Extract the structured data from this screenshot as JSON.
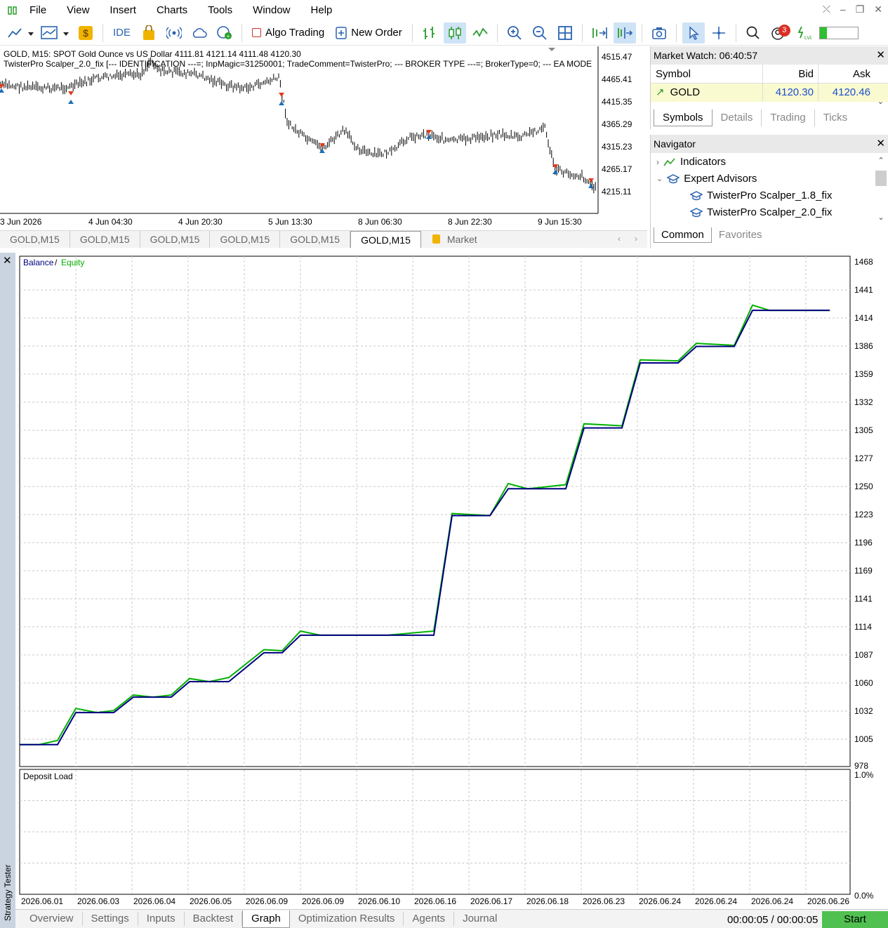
{
  "menu": [
    "File",
    "View",
    "Insert",
    "Charts",
    "Tools",
    "Window",
    "Help"
  ],
  "toolbar": {
    "ide_label": "IDE",
    "algo_trading_label": "Algo Trading",
    "new_order_label": "New Order",
    "notification_count": "3"
  },
  "price_chart": {
    "info_line1": "GOLD, M15:  SPOT Gold Ounce vs US Dollar  4111.81 4121.14 4111.48 4120.30",
    "info_line2": "TwisterPro Scalper_2.0_fix [--- IDENTIFICATION ---=; InpMagic=31250001; TradeComment=TwisterPro; --- BROKER TYPE ---=; BrokerType=0; --- EA MODE",
    "price_ticks": [
      "4515.47",
      "4465.41",
      "4415.35",
      "4365.29",
      "4315.23",
      "4265.17",
      "4215.11"
    ],
    "time_ticks": [
      "3 Jun 2026",
      "4 Jun 04:30",
      "4 Jun 20:30",
      "5 Jun 13:30",
      "8 Jun 06:30",
      "8 Jun 22:30",
      "9 Jun 15:30"
    ]
  },
  "chart_tabs": [
    "GOLD,M15",
    "GOLD,M15",
    "GOLD,M15",
    "GOLD,M15",
    "GOLD,M15",
    "GOLD,M15",
    "Market"
  ],
  "market_watch": {
    "title": "Market Watch: 06:40:57",
    "col_symbol": "Symbol",
    "col_bid": "Bid",
    "col_ask": "Ask",
    "symbol": "GOLD",
    "bid": "4120.30",
    "ask": "4120.46",
    "tabs": [
      "Symbols",
      "Details",
      "Trading",
      "Ticks"
    ]
  },
  "navigator": {
    "title": "Navigator",
    "indicators": "Indicators",
    "expert_advisors": "Expert Advisors",
    "ea1": "TwisterPro Scalper_1.8_fix",
    "ea2": "TwisterPro Scalper_2.0_fix",
    "tabs": [
      "Common",
      "Favorites"
    ]
  },
  "tester": {
    "side_label": "Strategy Tester",
    "tabs": [
      "Overview",
      "Settings",
      "Inputs",
      "Backtest",
      "Graph",
      "Optimization Results",
      "Agents",
      "Journal"
    ],
    "time": "00:00:05 / 00:00:05",
    "start_label": "Start"
  },
  "chart_data": [
    {
      "type": "line",
      "legend": [
        "Balance",
        "Equity"
      ],
      "y_ticks": [
        "1468",
        "1441",
        "1414",
        "1386",
        "1359",
        "1332",
        "1305",
        "1277",
        "1250",
        "1223",
        "1196",
        "1169",
        "1141",
        "1114",
        "1087",
        "1060",
        "1032",
        "1005",
        "978"
      ],
      "x_ticks": [
        "2026.06.01",
        "2026.06.03",
        "2026.06.04",
        "2026.06.05",
        "2026.06.09",
        "2026.06.09",
        "2026.06.10",
        "2026.06.16",
        "2026.06.17",
        "2026.06.18",
        "2026.06.23",
        "2026.06.24",
        "2026.06.24",
        "2026.06.24",
        "2026.06.26"
      ],
      "ylim": [
        978,
        1468
      ],
      "series": [
        {
          "name": "Balance",
          "color": "#000080",
          "values": [
            1000,
            1000,
            1000,
            1031,
            1031,
            1031,
            1046,
            1046,
            1046,
            1061,
            1061,
            1061,
            1089,
            1089,
            1106,
            1106,
            1106,
            1106,
            1106,
            1222,
            1222,
            1248,
            1248,
            1248,
            1307,
            1307,
            1370,
            1370,
            1386,
            1386,
            1421,
            1421,
            1421,
            1421
          ]
        },
        {
          "name": "Equity",
          "color": "#00b000",
          "values": [
            1000,
            1000,
            1004,
            1035,
            1031,
            1033,
            1048,
            1046,
            1048,
            1064,
            1061,
            1065,
            1092,
            1091,
            1110,
            1106,
            1106,
            1106,
            1110,
            1224,
            1222,
            1253,
            1248,
            1252,
            1311,
            1309,
            1373,
            1372,
            1389,
            1387,
            1426,
            1421,
            1421,
            1421
          ]
        }
      ]
    },
    {
      "type": "area",
      "title": "Deposit Load",
      "y_ticks": [
        "1.0%",
        "0.0%"
      ],
      "values": []
    }
  ]
}
